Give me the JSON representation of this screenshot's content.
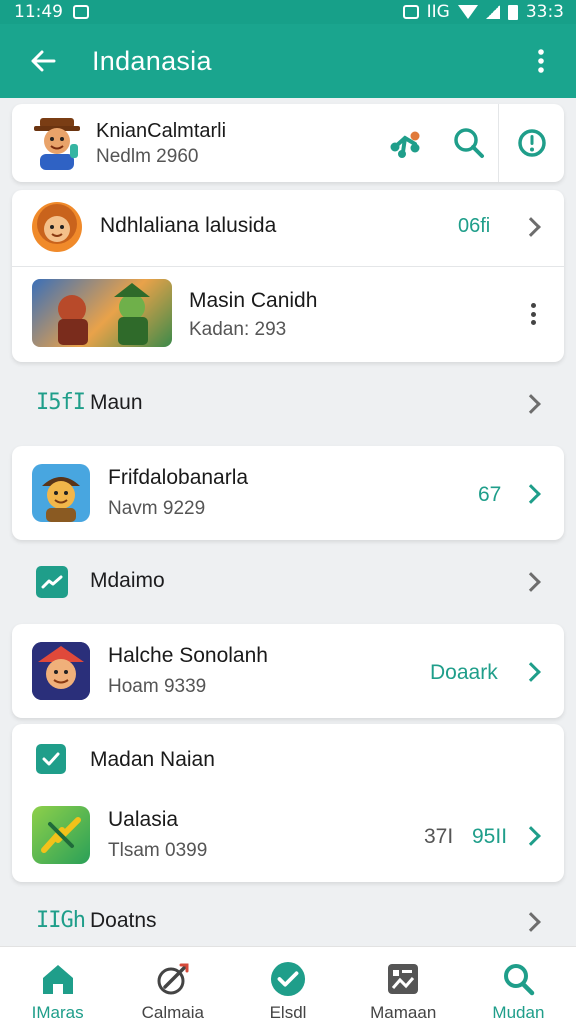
{
  "status_bar": {
    "time": "11:49",
    "right_text": "IIG",
    "battery_text": "33:3"
  },
  "app_bar": {
    "title": "Indanasia"
  },
  "profile_card": {
    "name": "KnianCalmtarli",
    "subtitle": "Nedlm 2960"
  },
  "group_card": {
    "row1": {
      "title": "Ndhlaliana lalusida",
      "value": "06fi"
    },
    "row2": {
      "title": "Masin Canidh",
      "subtitle": "Kadan: 293"
    }
  },
  "section_main": {
    "icon_text": "I5fI",
    "label": "Maun"
  },
  "item_friend": {
    "title": "Frifdalobanarla",
    "subtitle": "Navm 9229",
    "value": "67"
  },
  "section_mudaimo": {
    "label": "Mdaimo"
  },
  "item_halche": {
    "title": "Halche Sonolanh",
    "subtitle": "Hoam 9339",
    "value": "Doaark"
  },
  "group_madan": {
    "header_label": "Madan Naian",
    "item": {
      "title": "Ualasia",
      "subtitle": "Tlsam 0399",
      "value_a": "37I",
      "value_b": "95II"
    }
  },
  "section_doatns": {
    "icon_text": "IIGh",
    "label": "Doatns"
  },
  "bottom_nav": {
    "items": [
      {
        "label": "IMaras",
        "icon": "home-icon",
        "active": true
      },
      {
        "label": "Calmaia",
        "icon": "rocket-icon",
        "active": false
      },
      {
        "label": "Elsdl",
        "icon": "check-circle-icon",
        "active": false
      },
      {
        "label": "Mamaan",
        "icon": "gallery-icon",
        "active": false
      },
      {
        "label": "Mudan",
        "icon": "search-icon",
        "active": true
      }
    ]
  },
  "colors": {
    "accent": "#1aa58e",
    "teal_text": "#1f9e8a",
    "background": "#eef0f2"
  }
}
